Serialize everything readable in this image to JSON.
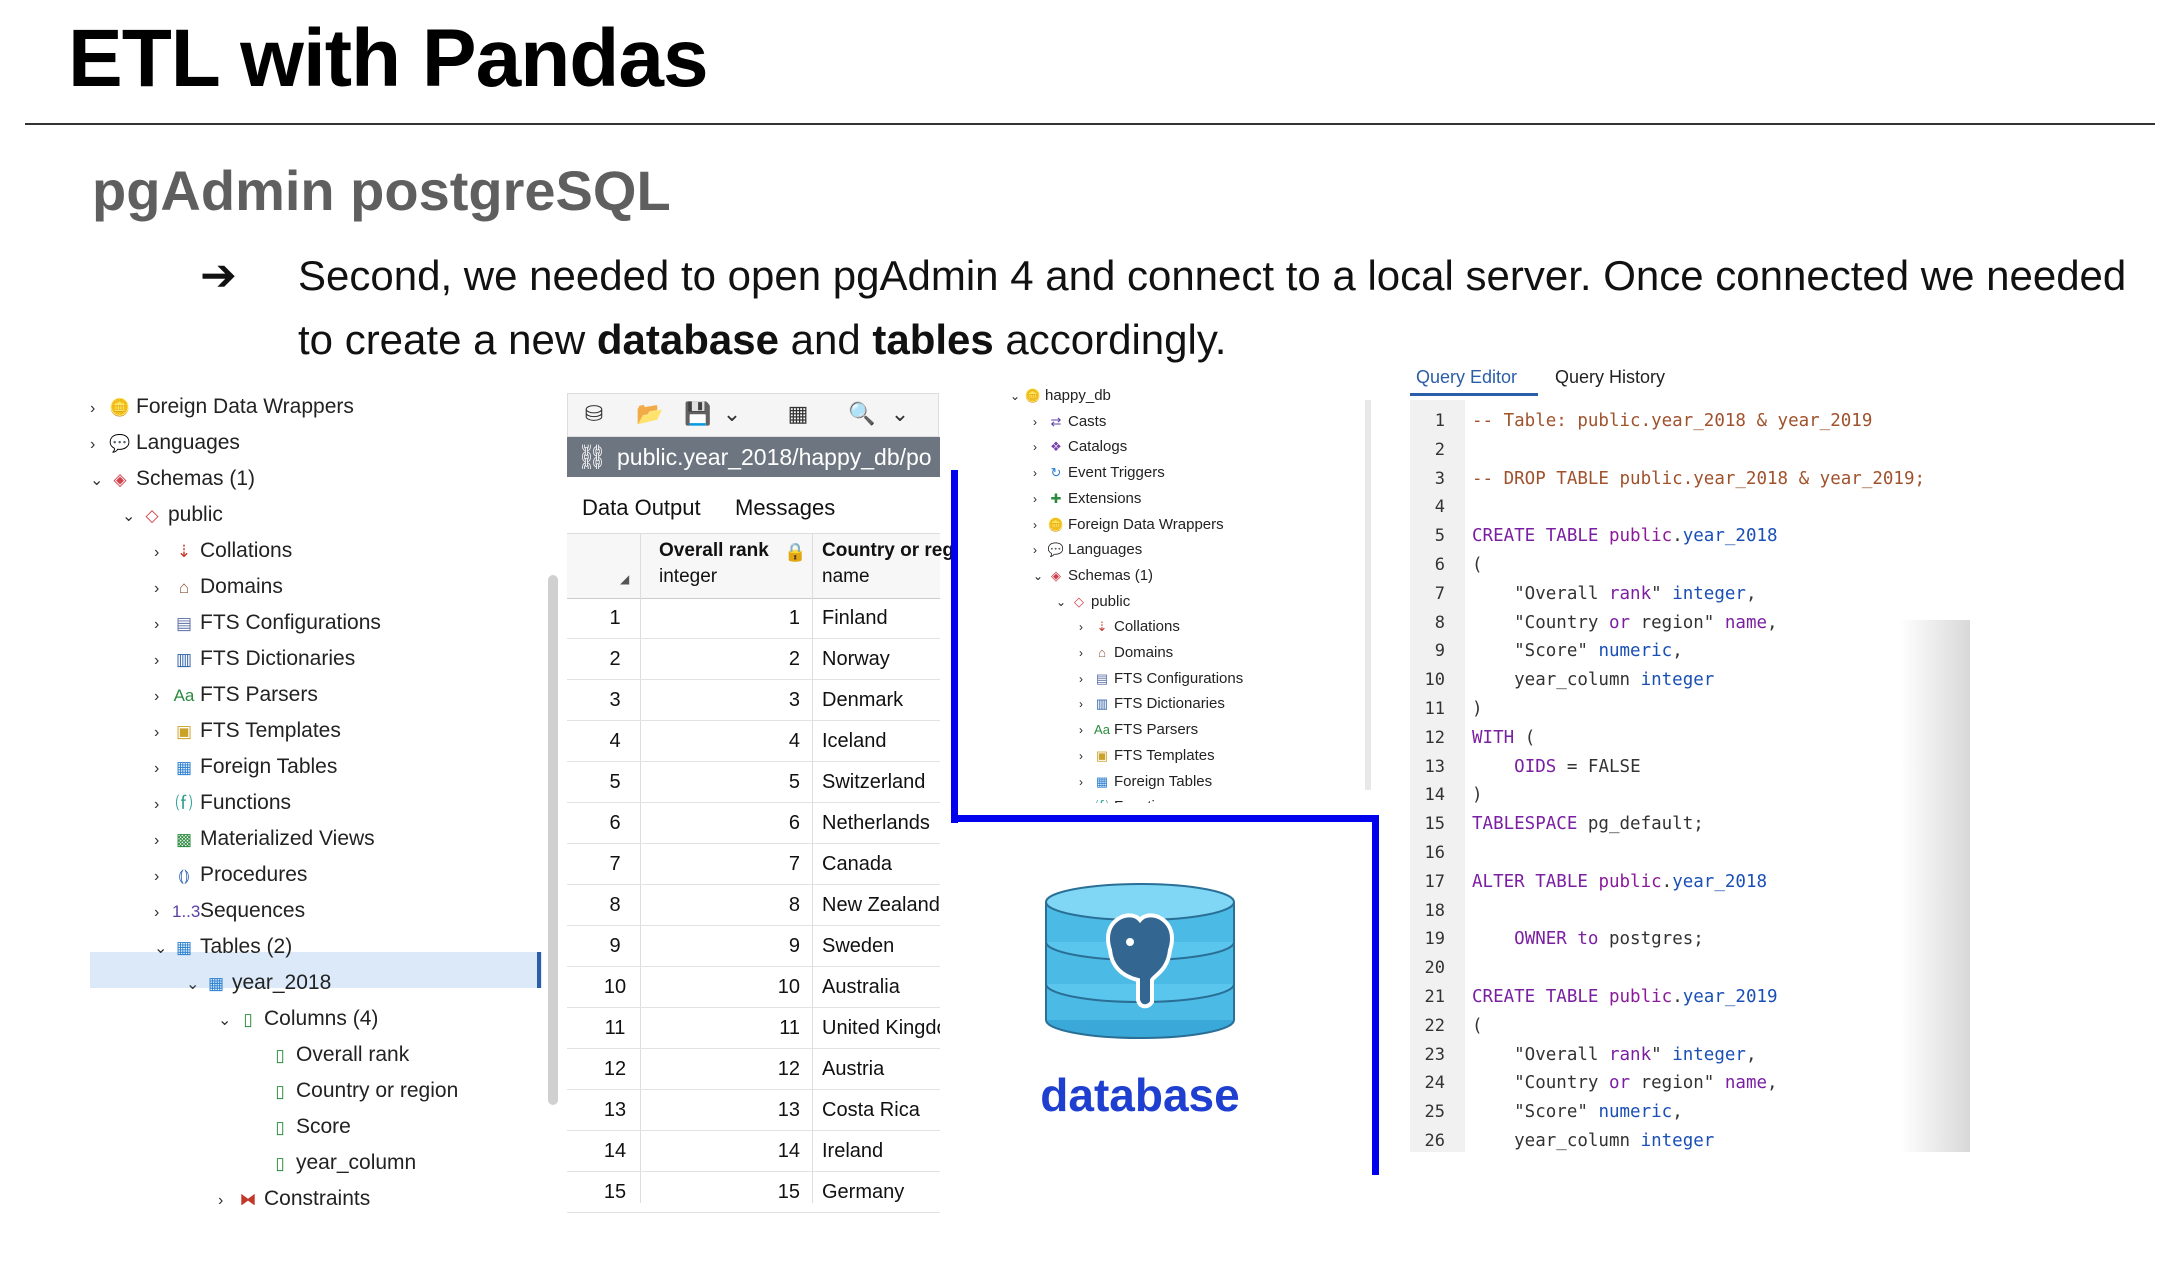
{
  "slide": {
    "title": "ETL with Pandas",
    "subtitle": "pgAdmin postgreSQL",
    "arrow": "➔",
    "body_line1": "Second, we needed to open pgAdmin 4 and connect to a local server.  Once connected we needed",
    "body_line2_pre": "to create a new ",
    "body_line2_b1": "database",
    "body_line2_mid": " and ",
    "body_line2_b2": "tables",
    "body_line2_post": " accordingly."
  },
  "tree": [
    {
      "label": "Foreign Data Wrappers",
      "icon": "🪙",
      "chev": "›"
    },
    {
      "label": "Languages",
      "icon": "💬",
      "chev": "›"
    },
    {
      "label": "Schemas (1)",
      "icon": "◈",
      "chev": "⌄"
    },
    {
      "label": "public",
      "icon": "◇",
      "chev": "⌄"
    },
    {
      "label": "Collations",
      "icon": "⇣",
      "chev": "›"
    },
    {
      "label": "Domains",
      "icon": "⌂",
      "chev": "›"
    },
    {
      "label": "FTS Configurations",
      "icon": "▤",
      "chev": "›"
    },
    {
      "label": "FTS Dictionaries",
      "icon": "▥",
      "chev": "›"
    },
    {
      "label": "FTS Parsers",
      "icon": "Aa",
      "chev": "›"
    },
    {
      "label": "FTS Templates",
      "icon": "▣",
      "chev": "›"
    },
    {
      "label": "Foreign Tables",
      "icon": "▦",
      "chev": "›"
    },
    {
      "label": "Functions",
      "icon": "⒡",
      "chev": "›"
    },
    {
      "label": "Materialized Views",
      "icon": "▩",
      "chev": "›"
    },
    {
      "label": "Procedures",
      "icon": "⦅⦆",
      "chev": "›"
    },
    {
      "label": "Sequences",
      "icon": "1..3",
      "chev": "›"
    },
    {
      "label": "Tables (2)",
      "icon": "▦",
      "chev": "⌄"
    },
    {
      "label": "year_2018",
      "icon": "▦",
      "chev": "⌄"
    },
    {
      "label": "Columns (4)",
      "icon": "▯",
      "chev": "⌄"
    },
    {
      "label": "Overall rank",
      "icon": "▯",
      "chev": ""
    },
    {
      "label": "Country or region",
      "icon": "▯",
      "chev": ""
    },
    {
      "label": "Score",
      "icon": "▯",
      "chev": ""
    },
    {
      "label": "year_column",
      "icon": "▯",
      "chev": ""
    },
    {
      "label": "Constraints",
      "icon": "⧓",
      "chev": "›"
    }
  ],
  "data_output": {
    "path": "public.year_2018/happy_db/po",
    "tabs": [
      "Data Output",
      "Messages"
    ],
    "col1_name": "Overall rank",
    "col1_type": "integer",
    "col2_name": "Country or reg",
    "col2_type": "name",
    "rows": [
      {
        "n": "1",
        "rank": "1",
        "country": "Finland"
      },
      {
        "n": "2",
        "rank": "2",
        "country": "Norway"
      },
      {
        "n": "3",
        "rank": "3",
        "country": "Denmark"
      },
      {
        "n": "4",
        "rank": "4",
        "country": "Iceland"
      },
      {
        "n": "5",
        "rank": "5",
        "country": "Switzerland"
      },
      {
        "n": "6",
        "rank": "6",
        "country": "Netherlands"
      },
      {
        "n": "7",
        "rank": "7",
        "country": "Canada"
      },
      {
        "n": "8",
        "rank": "8",
        "country": "New Zealand"
      },
      {
        "n": "9",
        "rank": "9",
        "country": "Sweden"
      },
      {
        "n": "10",
        "rank": "10",
        "country": "Australia"
      },
      {
        "n": "11",
        "rank": "11",
        "country": "United Kingdo"
      },
      {
        "n": "12",
        "rank": "12",
        "country": "Austria"
      },
      {
        "n": "13",
        "rank": "13",
        "country": "Costa Rica"
      },
      {
        "n": "14",
        "rank": "14",
        "country": "Ireland"
      },
      {
        "n": "15",
        "rank": "15",
        "country": "Germany"
      }
    ]
  },
  "small_tree": [
    {
      "label": "happy_db",
      "icon": "🪙",
      "chev": "⌄",
      "indent": 0
    },
    {
      "label": "Casts",
      "icon": "⇄",
      "chev": "›",
      "indent": 1
    },
    {
      "label": "Catalogs",
      "icon": "❖",
      "chev": "›",
      "indent": 1
    },
    {
      "label": "Event Triggers",
      "icon": "↻",
      "chev": "›",
      "indent": 1
    },
    {
      "label": "Extensions",
      "icon": "✚",
      "chev": "›",
      "indent": 1
    },
    {
      "label": "Foreign Data Wrappers",
      "icon": "🪙",
      "chev": "›",
      "indent": 1
    },
    {
      "label": "Languages",
      "icon": "💬",
      "chev": "›",
      "indent": 1
    },
    {
      "label": "Schemas (1)",
      "icon": "◈",
      "chev": "⌄",
      "indent": 1
    },
    {
      "label": "public",
      "icon": "◇",
      "chev": "⌄",
      "indent": 2
    },
    {
      "label": "Collations",
      "icon": "⇣",
      "chev": "›",
      "indent": 3
    },
    {
      "label": "Domains",
      "icon": "⌂",
      "chev": "›",
      "indent": 3
    },
    {
      "label": "FTS Configurations",
      "icon": "▤",
      "chev": "›",
      "indent": 3
    },
    {
      "label": "FTS Dictionaries",
      "icon": "▥",
      "chev": "›",
      "indent": 3
    },
    {
      "label": "FTS Parsers",
      "icon": "Aa",
      "chev": "›",
      "indent": 3
    },
    {
      "label": "FTS Templates",
      "icon": "▣",
      "chev": "›",
      "indent": 3
    },
    {
      "label": "Foreign Tables",
      "icon": "▦",
      "chev": "›",
      "indent": 3
    },
    {
      "label": "Functions",
      "icon": "⒡",
      "chev": "›",
      "indent": 3
    }
  ],
  "database_label": "database",
  "query": {
    "tabs": [
      "Query Editor",
      "Query History"
    ],
    "lines": [
      [
        [
          "c-com",
          "-- Table: public.year_2018 & year_2019"
        ]
      ],
      [],
      [
        [
          "c-com",
          "-- DROP TABLE public.year_2018 & year_2019;"
        ]
      ],
      [],
      [
        [
          "c-kw",
          "CREATE TABLE "
        ],
        [
          "c-kw2",
          "public"
        ],
        [
          "c-def",
          "."
        ],
        [
          "c-typ",
          "year_2018"
        ]
      ],
      [
        [
          "c-def",
          "("
        ]
      ],
      [
        [
          "c-def",
          "    \"Overall "
        ],
        [
          "c-kw",
          "rank"
        ],
        [
          "c-def",
          "\" "
        ],
        [
          "c-typ",
          "integer"
        ],
        [
          "c-def",
          ","
        ]
      ],
      [
        [
          "c-def",
          "    \"Country "
        ],
        [
          "c-kw",
          "or"
        ],
        [
          "c-def",
          " region\" "
        ],
        [
          "c-kw",
          "name"
        ],
        [
          "c-def",
          ","
        ]
      ],
      [
        [
          "c-def",
          "    \"Score\" "
        ],
        [
          "c-typ",
          "numeric"
        ],
        [
          "c-def",
          ","
        ]
      ],
      [
        [
          "c-def",
          "    year_column "
        ],
        [
          "c-typ",
          "integer"
        ]
      ],
      [
        [
          "c-def",
          ")"
        ]
      ],
      [
        [
          "c-kw",
          "WITH"
        ],
        [
          "c-def",
          " ("
        ]
      ],
      [
        [
          "c-def",
          "    "
        ],
        [
          "c-kw",
          "OIDS"
        ],
        [
          "c-def",
          " = FALSE"
        ]
      ],
      [
        [
          "c-def",
          ")"
        ]
      ],
      [
        [
          "c-kw",
          "TABLESPACE"
        ],
        [
          "c-def",
          " pg_default;"
        ]
      ],
      [],
      [
        [
          "c-kw",
          "ALTER TABLE "
        ],
        [
          "c-kw2",
          "public"
        ],
        [
          "c-def",
          "."
        ],
        [
          "c-typ",
          "year_2018"
        ]
      ],
      [],
      [
        [
          "c-def",
          "    "
        ],
        [
          "c-kw",
          "OWNER to"
        ],
        [
          "c-def",
          " postgres;"
        ]
      ],
      [],
      [
        [
          "c-kw",
          "CREATE TABLE "
        ],
        [
          "c-kw2",
          "public"
        ],
        [
          "c-def",
          "."
        ],
        [
          "c-typ",
          "year_2019"
        ]
      ],
      [
        [
          "c-def",
          "("
        ]
      ],
      [
        [
          "c-def",
          "    \"Overall "
        ],
        [
          "c-kw",
          "rank"
        ],
        [
          "c-def",
          "\" "
        ],
        [
          "c-typ",
          "integer"
        ],
        [
          "c-def",
          ","
        ]
      ],
      [
        [
          "c-def",
          "    \"Country "
        ],
        [
          "c-kw",
          "or"
        ],
        [
          "c-def",
          " region\" "
        ],
        [
          "c-kw",
          "name"
        ],
        [
          "c-def",
          ","
        ]
      ],
      [
        [
          "c-def",
          "    \"Score\" "
        ],
        [
          "c-typ",
          "numeric"
        ],
        [
          "c-def",
          ","
        ]
      ],
      [
        [
          "c-def",
          "    year_column "
        ],
        [
          "c-typ",
          "integer"
        ]
      ]
    ]
  }
}
